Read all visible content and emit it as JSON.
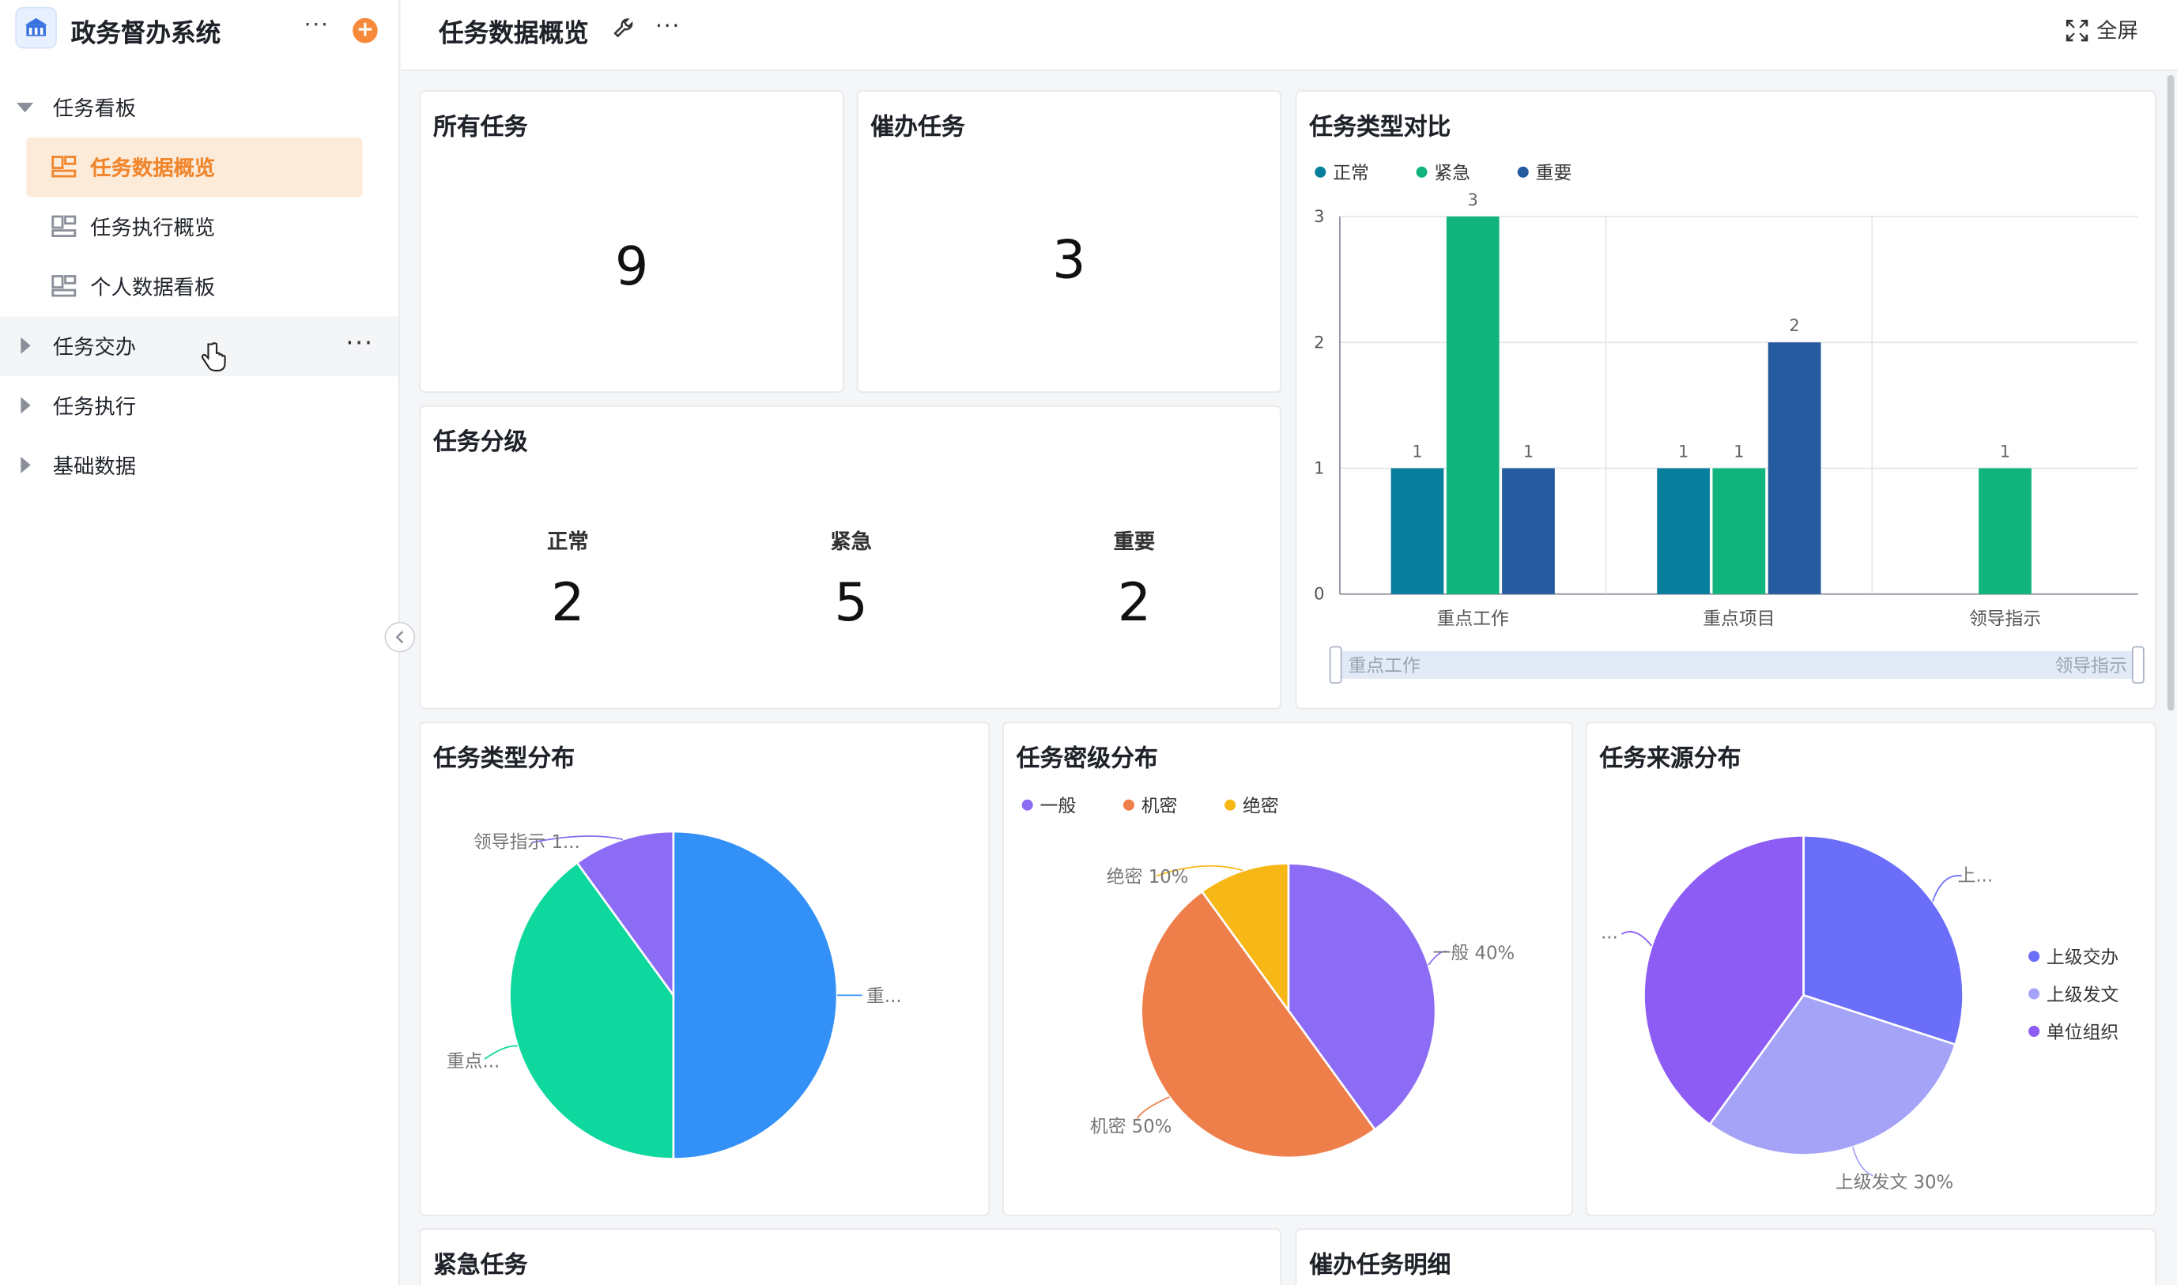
{
  "app": {
    "title": "政务督办系统",
    "more": "···",
    "add": "+"
  },
  "sidebar": {
    "groups": [
      {
        "label": "任务看板",
        "expanded": true,
        "items": [
          {
            "label": "任务数据概览",
            "active": true
          },
          {
            "label": "任务执行概览",
            "active": false
          },
          {
            "label": "个人数据看板",
            "active": false
          }
        ]
      },
      {
        "label": "任务交办",
        "expanded": false
      },
      {
        "label": "任务执行",
        "expanded": false
      },
      {
        "label": "基础数据",
        "expanded": false
      }
    ],
    "row_more": "···"
  },
  "header": {
    "title": "任务数据概览",
    "more": "···",
    "fullscreen": "全屏"
  },
  "cards": {
    "all_tasks": {
      "title": "所有任务",
      "value": "9"
    },
    "urge_tasks": {
      "title": "催办任务",
      "value": "3"
    },
    "grading": {
      "title": "任务分级",
      "items": [
        {
          "label": "正常",
          "value": "2"
        },
        {
          "label": "紧急",
          "value": "5"
        },
        {
          "label": "重要",
          "value": "2"
        }
      ]
    },
    "type_compare": {
      "title": "任务类型对比"
    },
    "type_dist": {
      "title": "任务类型分布"
    },
    "secret_dist": {
      "title": "任务密级分布"
    },
    "source_dist": {
      "title": "任务来源分布"
    },
    "urgent_tasks": {
      "title": "紧急任务"
    },
    "urge_detail": {
      "title": "催办任务明细"
    }
  },
  "colors": {
    "accent": "#f0852c",
    "normal": "#087e9e",
    "urgent": "#10b47c",
    "important": "#265b9f"
  },
  "chart_data": [
    {
      "type": "bar",
      "categories": [
        "重点工作",
        "重点项目",
        "领导指示"
      ],
      "series": [
        {
          "name": "正常",
          "values": [
            1,
            1,
            0
          ],
          "color": "#087e9e"
        },
        {
          "name": "紧急",
          "values": [
            3,
            1,
            1
          ],
          "color": "#10b47c"
        },
        {
          "name": "重要",
          "values": [
            1,
            2,
            0
          ],
          "color": "#265b9f"
        }
      ],
      "yticks": [
        "0",
        "1",
        "2",
        "3"
      ],
      "ylim": [
        0,
        3
      ],
      "data_labels": [
        "1",
        "3",
        "1",
        "1",
        "1",
        "2",
        "1"
      ],
      "zoom_slider": {
        "start_label": "重点工作",
        "end_label": "领导指示"
      },
      "legend": "top-left"
    },
    {
      "type": "pie",
      "slices": [
        {
          "label": "重...",
          "value": 50,
          "color": "#3390f7"
        },
        {
          "label": "重点...",
          "value": 40,
          "color": "#0ed89d"
        },
        {
          "label": "领导指示 1...",
          "value": 10,
          "color": "#8c6cf4"
        }
      ]
    },
    {
      "type": "pie",
      "legend_items": [
        {
          "name": "一般",
          "color": "#8c6cf4"
        },
        {
          "name": "机密",
          "color": "#ef7f4a"
        },
        {
          "name": "绝密",
          "color": "#f7b817"
        }
      ],
      "slices": [
        {
          "label": "一般 40%",
          "value": 40,
          "color": "#8c6cf4"
        },
        {
          "label": "机密 50%",
          "value": 50,
          "color": "#ef7f4a"
        },
        {
          "label": "绝密 10%",
          "value": 10,
          "color": "#f7b817"
        }
      ]
    },
    {
      "type": "pie",
      "legend_items": [
        {
          "name": "上级交办",
          "color": "#6a6ef8"
        },
        {
          "name": "上级发文",
          "color": "#a5a3f8"
        },
        {
          "name": "单位组织",
          "color": "#8c5cf4"
        }
      ],
      "slices": [
        {
          "label": "上...",
          "value": 30,
          "color": "#6a6ef8"
        },
        {
          "label": "上级发文 30%",
          "value": 30,
          "color": "#a5a3f8"
        },
        {
          "label": "...",
          "value": 40,
          "color": "#8c5cf4"
        }
      ]
    }
  ]
}
